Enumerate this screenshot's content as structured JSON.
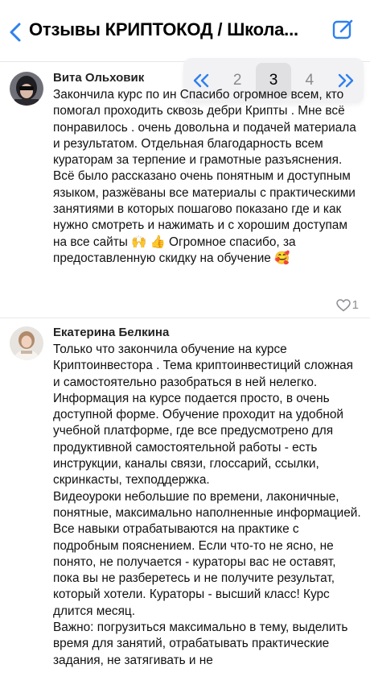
{
  "header": {
    "title": "Отзывы КРИПТОКОД / Школа...",
    "back_icon": "chevron-left-icon",
    "compose_icon": "compose-icon",
    "accent_color": "#2f80ed"
  },
  "pagination": {
    "first_icon": "double-chevron-left-icon",
    "last_icon": "double-chevron-right-icon",
    "pages": [
      "2",
      "3",
      "4"
    ],
    "current": "3"
  },
  "reviews": [
    {
      "author": "Вита Ольховик",
      "paragraphs": [
        "Закончила курс по ин Спасибо огромное всем, кто помогал проходить сквозь дебри Крипты . Мне всё понравилось . очень довольна и подачей материала и результатом. Отдельная благодарность всем кураторам за терпение и грамотные разъяснения. Всё было рассказано очень понятным и доступным языком, разжёваны все материалы с практическими занятиями в которых пошагово показано где и как нужно смотреть и нажимать и с хорошим доступам на все сайты 🙌 👍 Огромное спасибо, за предоставленную скидку на обучение 🥰"
      ],
      "likes": "1"
    },
    {
      "author": "Екатерина Белкина",
      "paragraphs": [
        "Только что закончила обучение на курсе Криптоинвестора . Тема криптоинвестиций сложная и самостоятельно разобраться в ней нелегко. Информация на курсе подается просто, в очень доступной форме. Обучение проходит на удобной учебной платформе, где все предусмотрено для продуктивной самостоятельной работы - есть инструкции, каналы связи, глоссарий, ссылки, скринкасты, техподдержка.",
        "Видеоуроки небольшие по времени, лаконичные, понятные, максимально наполненные информацией. Все навыки отрабатываются на практике с подробным пояснением. Если что-то не ясно, не понято, не получается - кураторы вас не оставят, пока вы не разберетесь и не получите результат, который хотели. Кураторы - высший класс! Курс длится месяц.",
        "Важно: погрузиться максимально в тему, выделить время для занятий, отрабатывать практические задания, не затягивать и не"
      ],
      "likes": ""
    }
  ]
}
